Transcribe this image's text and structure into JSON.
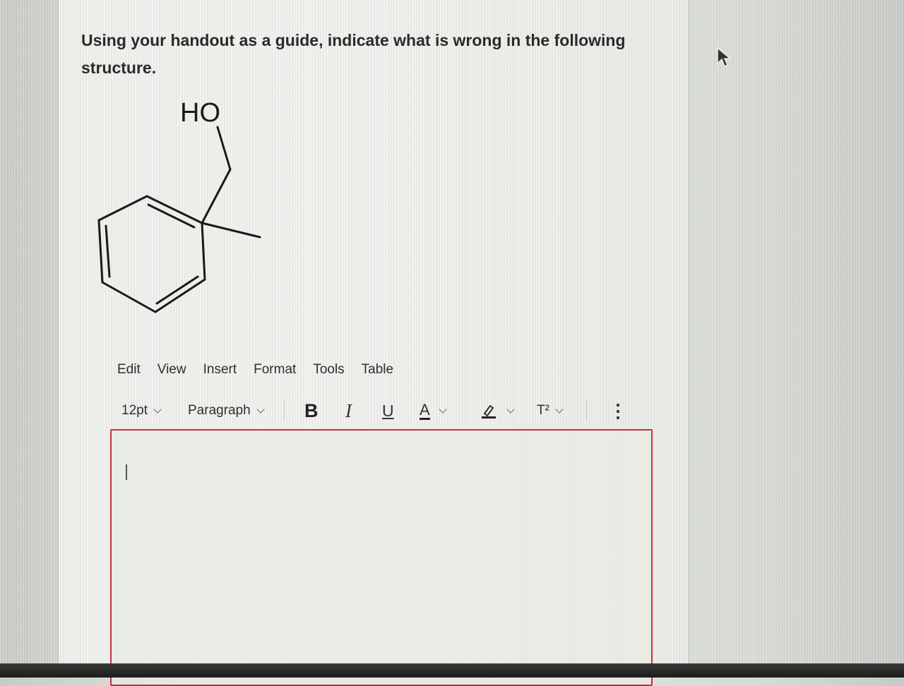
{
  "question": {
    "line1": "Using your handout as a guide, indicate what is wrong in the following",
    "line2": "structure."
  },
  "structure": {
    "label": "HO"
  },
  "menubar": [
    "Edit",
    "View",
    "Insert",
    "Format",
    "Tools",
    "Table"
  ],
  "toolbar": {
    "font_size": "12pt",
    "block_format": "Paragraph",
    "bold": "B",
    "italic": "I",
    "underline": "U",
    "text_color": "A",
    "superscript": "T²",
    "more": "⋮"
  },
  "colors": {
    "editor_border": "#c4303e"
  }
}
